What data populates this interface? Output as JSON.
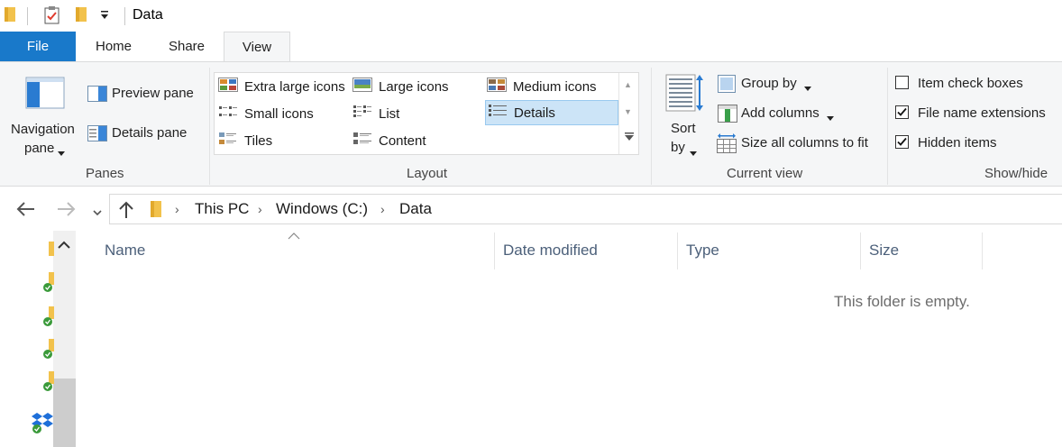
{
  "window": {
    "title": "Data"
  },
  "ribbon_tabs": [
    "File",
    "Home",
    "Share",
    "View"
  ],
  "panes_group": {
    "label": "Panes",
    "navigation_pane_line1": "Navigation",
    "navigation_pane_line2": "pane",
    "preview_pane": "Preview pane",
    "details_pane": "Details pane"
  },
  "layout_group": {
    "label": "Layout",
    "items": [
      "Extra large icons",
      "Large icons",
      "Medium icons",
      "Small icons",
      "List",
      "Details",
      "Tiles",
      "Content"
    ],
    "selected": "Details"
  },
  "current_view_group": {
    "label": "Current view",
    "sort_line1": "Sort",
    "sort_line2": "by",
    "group_by": "Group by",
    "add_columns": "Add columns",
    "size_all_columns": "Size all columns to fit"
  },
  "show_hide_group": {
    "label": "Show/hide",
    "item_check_boxes": "Item check boxes",
    "file_name_extensions": "File name extensions",
    "hidden_items": "Hidden items",
    "checked": {
      "item_check_boxes": false,
      "file_name_extensions": true,
      "hidden_items": true
    }
  },
  "breadcrumb": [
    "This PC",
    "Windows (C:)",
    "Data"
  ],
  "columns": [
    "Name",
    "Date modified",
    "Type",
    "Size"
  ],
  "empty_message": "This folder is empty.",
  "colors": {
    "file_tab": "#1979ca",
    "selected": "#cce4f7",
    "header_text": "#4c607a"
  }
}
